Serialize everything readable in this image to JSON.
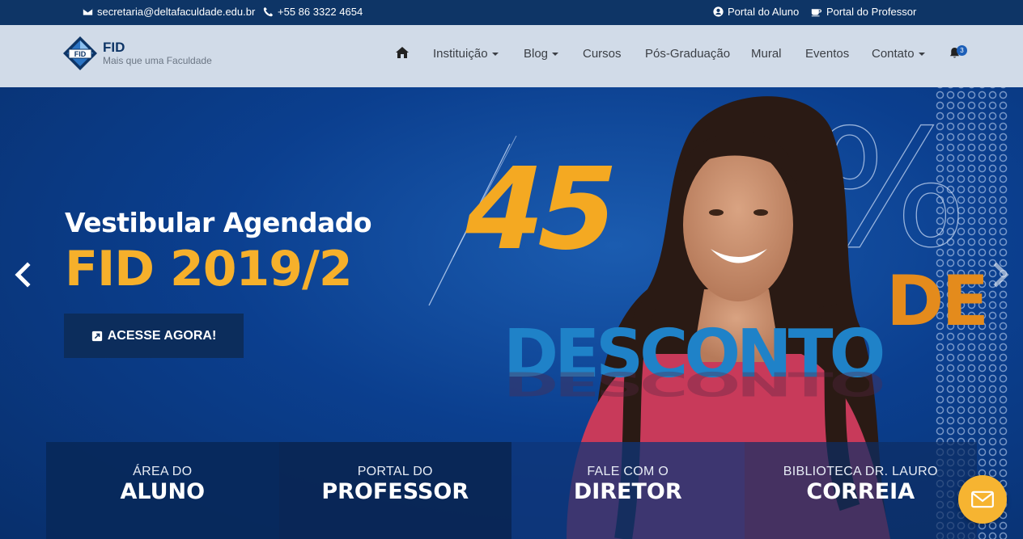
{
  "topbar": {
    "email": "secretaria@deltafaculdade.edu.br",
    "phone": "+55 86 3322 4654",
    "portal_aluno": "Portal do Aluno",
    "portal_professor": "Portal do Professor"
  },
  "brand": {
    "name": "FID",
    "tagline": "Mais que uma Faculdade",
    "logo_text": "FID"
  },
  "nav": {
    "items": [
      "Instituição",
      "Blog",
      "Cursos",
      "Pós-Graduação",
      "Mural",
      "Eventos",
      "Contato"
    ],
    "notification_count": "3"
  },
  "hero": {
    "title": "Vestibular Agendado",
    "subtitle": "FID 2019/2",
    "cta_label": "ACESSE AGORA!",
    "promo_number": "45",
    "promo_percent": "%",
    "promo_de": "DE",
    "promo_word": "DESCONTO"
  },
  "tiles": [
    {
      "small": "ÁREA DO",
      "big": "ALUNO"
    },
    {
      "small": "PORTAL DO",
      "big": "PROFESSOR"
    },
    {
      "small": "FALE COM O",
      "big": "DIRETOR"
    },
    {
      "small": "BIBLIOTECA DR. LAURO",
      "big": "CORREIA"
    }
  ],
  "colors": {
    "accent": "#f6b02b",
    "primary": "#0e3566",
    "promo_blue": "#1f82c8",
    "promo_orange": "#e48b1c"
  },
  "icons": [
    "envelope-icon",
    "phone-icon",
    "user-circle-icon",
    "coffee-icon",
    "home-icon",
    "bell-icon",
    "chevron-left-icon",
    "chevron-right-icon",
    "external-link-icon",
    "mail-icon"
  ]
}
